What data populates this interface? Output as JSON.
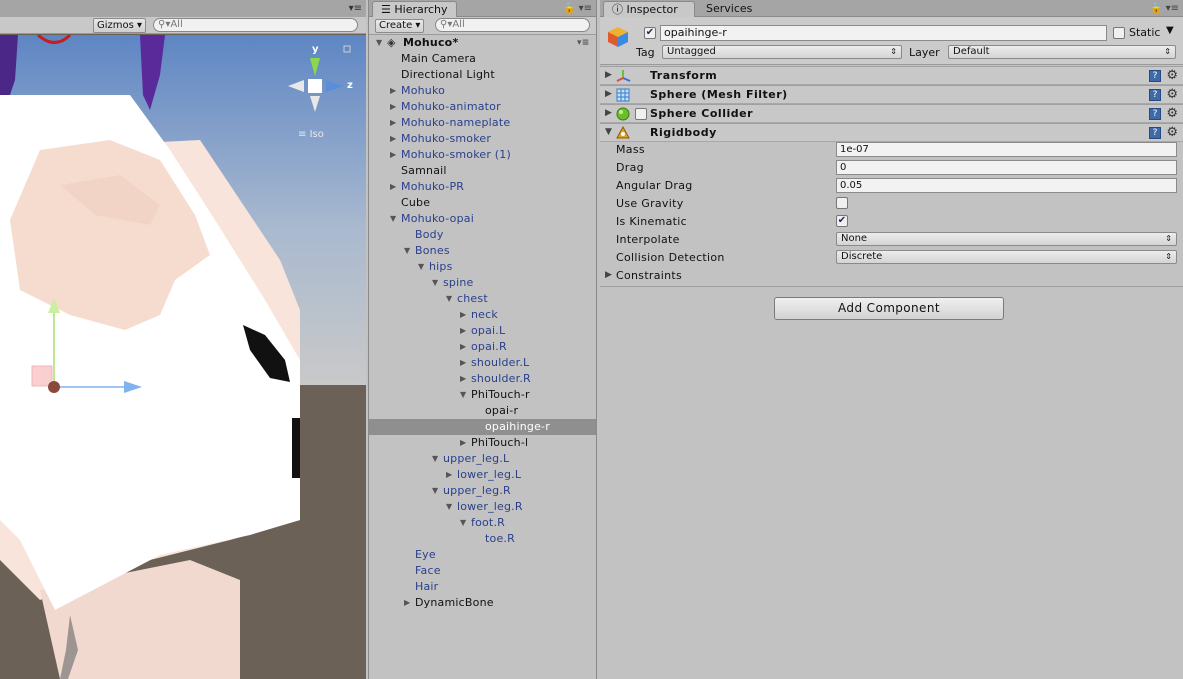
{
  "scene": {
    "gizmos_label": "Gizmos",
    "search_placeholder": "All",
    "axis_y": "y",
    "axis_z": "z",
    "projection_label": "Iso"
  },
  "hierarchy": {
    "tab_label": "Hierarchy",
    "create_label": "Create",
    "search_placeholder": "All",
    "items": [
      {
        "label": "Mohuco*",
        "depth": 0,
        "arrow": "down",
        "color": "black",
        "root": true
      },
      {
        "label": "Main Camera",
        "depth": 1,
        "arrow": "",
        "color": "black"
      },
      {
        "label": "Directional Light",
        "depth": 1,
        "arrow": "",
        "color": "black"
      },
      {
        "label": "Mohuko",
        "depth": 1,
        "arrow": "right",
        "color": "blue"
      },
      {
        "label": "Mohuko-animator",
        "depth": 1,
        "arrow": "right",
        "color": "blue"
      },
      {
        "label": "Mohuko-nameplate",
        "depth": 1,
        "arrow": "right",
        "color": "blue"
      },
      {
        "label": "Mohuko-smoker",
        "depth": 1,
        "arrow": "right",
        "color": "blue"
      },
      {
        "label": "Mohuko-smoker (1)",
        "depth": 1,
        "arrow": "right",
        "color": "blue"
      },
      {
        "label": "Samnail",
        "depth": 1,
        "arrow": "",
        "color": "black"
      },
      {
        "label": "Mohuko-PR",
        "depth": 1,
        "arrow": "right",
        "color": "blue"
      },
      {
        "label": "Cube",
        "depth": 1,
        "arrow": "",
        "color": "black"
      },
      {
        "label": "Mohuko-opai",
        "depth": 1,
        "arrow": "down",
        "color": "blue"
      },
      {
        "label": "Body",
        "depth": 2,
        "arrow": "",
        "color": "blue"
      },
      {
        "label": "Bones",
        "depth": 2,
        "arrow": "down",
        "color": "blue"
      },
      {
        "label": "hips",
        "depth": 3,
        "arrow": "down",
        "color": "blue"
      },
      {
        "label": "spine",
        "depth": 4,
        "arrow": "down",
        "color": "blue"
      },
      {
        "label": "chest",
        "depth": 5,
        "arrow": "down",
        "color": "blue"
      },
      {
        "label": "neck",
        "depth": 6,
        "arrow": "right",
        "color": "blue"
      },
      {
        "label": "opai.L",
        "depth": 6,
        "arrow": "right",
        "color": "blue"
      },
      {
        "label": "opai.R",
        "depth": 6,
        "arrow": "right",
        "color": "blue"
      },
      {
        "label": "shoulder.L",
        "depth": 6,
        "arrow": "right",
        "color": "blue"
      },
      {
        "label": "shoulder.R",
        "depth": 6,
        "arrow": "right",
        "color": "blue"
      },
      {
        "label": "PhiTouch-r",
        "depth": 6,
        "arrow": "down",
        "color": "black"
      },
      {
        "label": "opai-r",
        "depth": 7,
        "arrow": "",
        "color": "black"
      },
      {
        "label": "opaihinge-r",
        "depth": 7,
        "arrow": "",
        "color": "black",
        "selected": true
      },
      {
        "label": "PhiTouch-l",
        "depth": 6,
        "arrow": "right",
        "color": "black"
      },
      {
        "label": "upper_leg.L",
        "depth": 4,
        "arrow": "down",
        "color": "blue"
      },
      {
        "label": "lower_leg.L",
        "depth": 5,
        "arrow": "right",
        "color": "blue"
      },
      {
        "label": "upper_leg.R",
        "depth": 4,
        "arrow": "down",
        "color": "blue"
      },
      {
        "label": "lower_leg.R",
        "depth": 5,
        "arrow": "down",
        "color": "blue"
      },
      {
        "label": "foot.R",
        "depth": 6,
        "arrow": "down",
        "color": "blue"
      },
      {
        "label": "toe.R",
        "depth": 7,
        "arrow": "",
        "color": "blue"
      },
      {
        "label": "Eye",
        "depth": 2,
        "arrow": "",
        "color": "blue"
      },
      {
        "label": "Face",
        "depth": 2,
        "arrow": "",
        "color": "blue"
      },
      {
        "label": "Hair",
        "depth": 2,
        "arrow": "",
        "color": "blue"
      },
      {
        "label": "DynamicBone",
        "depth": 2,
        "arrow": "right",
        "color": "black"
      }
    ]
  },
  "inspector": {
    "tab_inspector": "Inspector",
    "tab_services": "Services",
    "object_name": "opaihinge-r",
    "active_checked": true,
    "static_label": "Static",
    "tag_label": "Tag",
    "tag_value": "Untagged",
    "layer_label": "Layer",
    "layer_value": "Default",
    "components": {
      "transform": "Transform",
      "mesh_filter": "Sphere (Mesh Filter)",
      "collider": "Sphere Collider",
      "rigidbody": "Rigidbody"
    },
    "rigidbody": {
      "mass_label": "Mass",
      "mass_value": "1e-07",
      "drag_label": "Drag",
      "drag_value": "0",
      "angular_drag_label": "Angular Drag",
      "angular_drag_value": "0.05",
      "use_gravity_label": "Use Gravity",
      "use_gravity": false,
      "is_kinematic_label": "Is Kinematic",
      "is_kinematic": true,
      "interpolate_label": "Interpolate",
      "interpolate_value": "None",
      "collision_label": "Collision Detection",
      "collision_value": "Discrete",
      "constraints_label": "Constraints"
    },
    "add_component_label": "Add Component"
  },
  "colors": {
    "blue_text": "#2a3f8c",
    "selection": "#8f8f8f",
    "help_icon": "#3f6aa8"
  }
}
